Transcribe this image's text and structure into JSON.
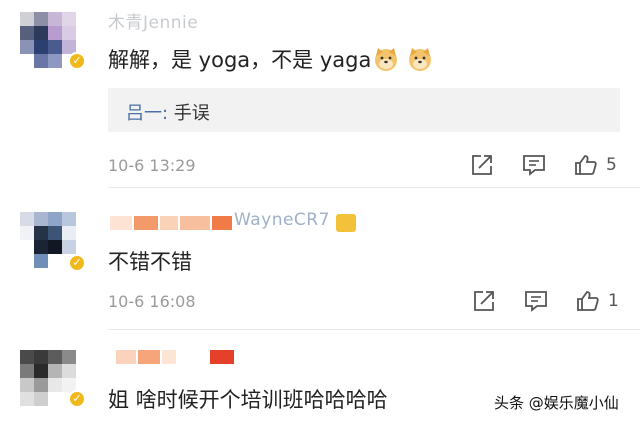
{
  "comments": [
    {
      "author": "木青Jennie",
      "content": "解解，是 yoga，不是 yaga",
      "emoji": [
        "doge-emoji",
        "doge-emoji"
      ],
      "reply": {
        "user": "吕一:",
        "text": " 手误"
      },
      "timestamp": "10-6 13:29",
      "likes": "5"
    },
    {
      "author": "WayneCR7",
      "content": "不错不错",
      "timestamp": "10-6 16:08",
      "likes": "1"
    },
    {
      "author": "",
      "content": "姐 啥时候开个培训班哈哈哈哈"
    }
  ],
  "icons": {
    "share": "share-icon",
    "comment": "comment-icon",
    "like": "thumbs-up-icon",
    "verified": "verified-badge-icon"
  },
  "colors": {
    "verified_badge": "#f1b81a",
    "reply_user": "#4a6fa5",
    "reply_bg": "#f2f2f2",
    "meta": "#9a9a9a"
  },
  "watermark": "头条 @娱乐魔小仙"
}
